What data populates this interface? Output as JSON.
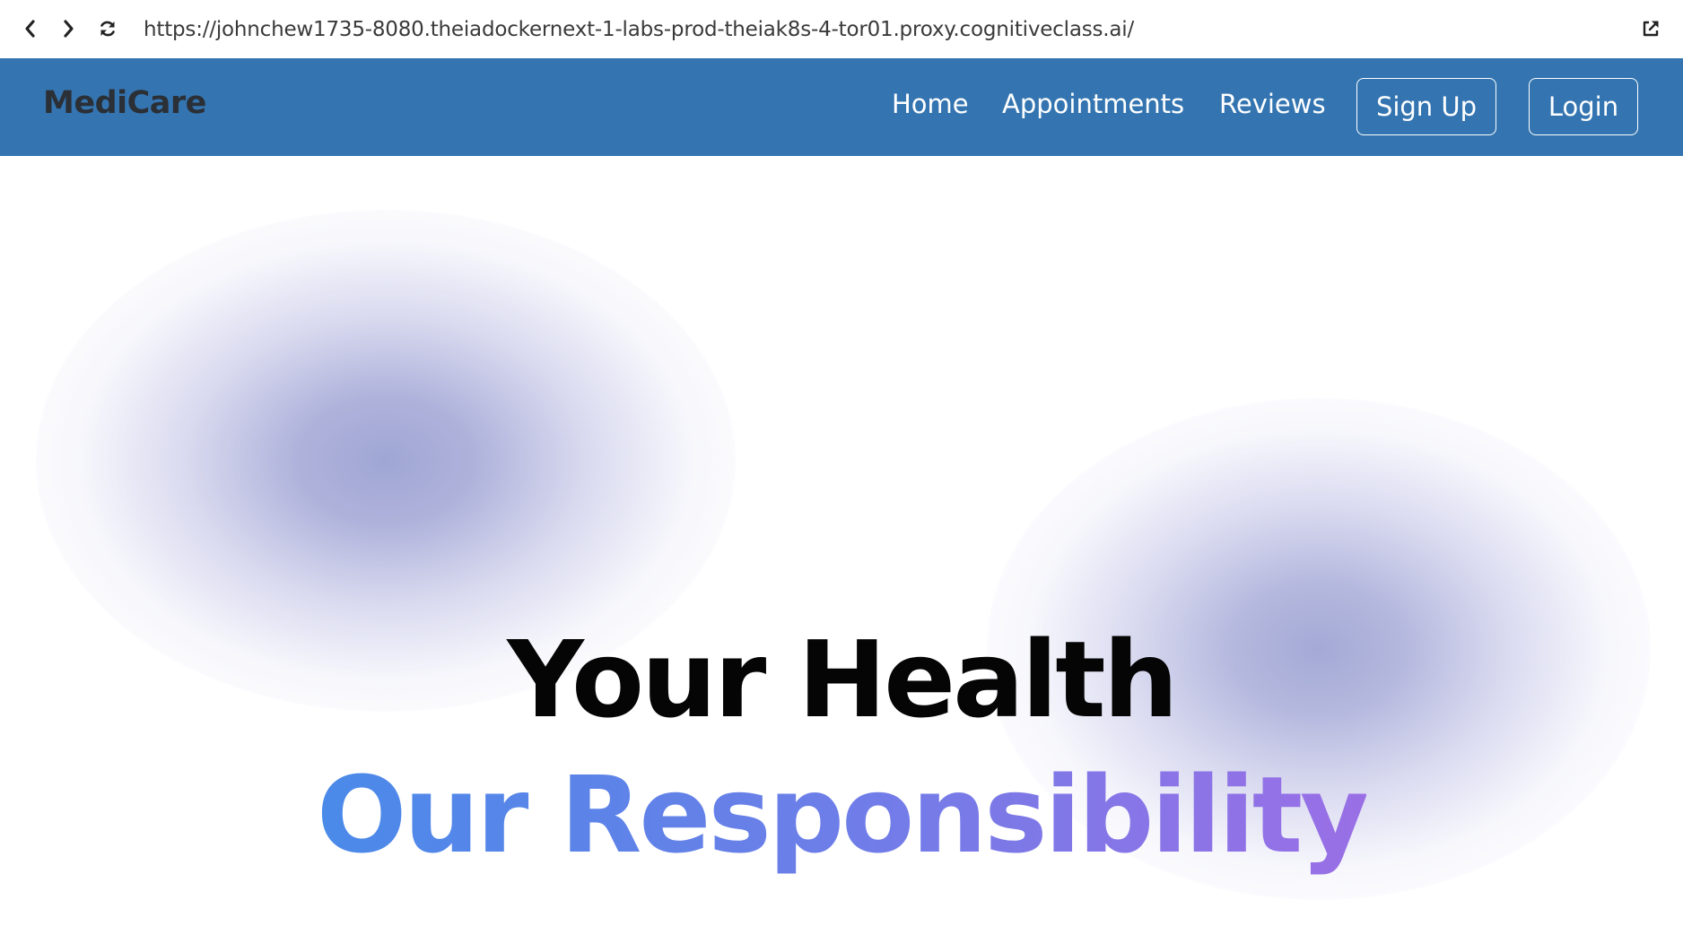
{
  "browser": {
    "url": "https://johnchew1735-8080.theiadockernext-1-labs-prod-theiak8s-4-tor01.proxy.cognitiveclass.ai/",
    "icons": {
      "back": "chevron-left-icon",
      "forward": "chevron-right-icon",
      "reload": "reload-icon",
      "external": "external-link-icon"
    }
  },
  "navbar": {
    "brand": "MediCare",
    "links": [
      {
        "label": "Home"
      },
      {
        "label": "Appointments"
      },
      {
        "label": "Reviews"
      }
    ],
    "buttons": {
      "signup": "Sign Up",
      "login": "Login"
    },
    "colors": {
      "background": "#3475b1",
      "brand": "#2b2f36",
      "text": "#ffffff"
    }
  },
  "hero": {
    "line1": "Your Health",
    "line2": "Our Responsibility",
    "colors": {
      "line1": "#050505",
      "line2_gradient_start": "#4a8ae9",
      "line2_gradient_end": "#9a6fe6",
      "blob": "#a0a6d4"
    }
  }
}
